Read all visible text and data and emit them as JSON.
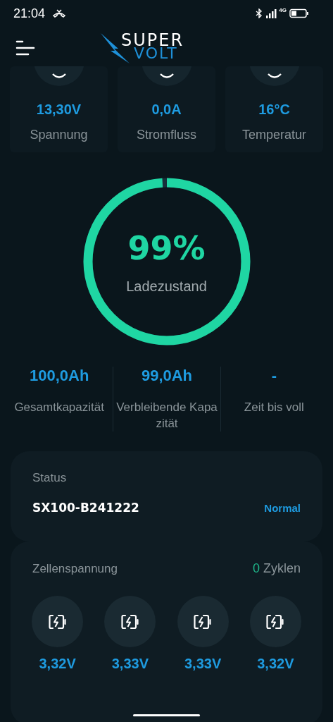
{
  "status_bar": {
    "time": "21:04",
    "network": "4G"
  },
  "header": {
    "logo_top": "SUPER",
    "logo_bottom": "VOLT"
  },
  "metrics": [
    {
      "value": "13,30V",
      "label": "Spannung"
    },
    {
      "value": "0,0A",
      "label": "Stromfluss"
    },
    {
      "value": "16°C",
      "label": "Temperatur"
    }
  ],
  "charge": {
    "percent": "99%",
    "label": "Ladezustand",
    "level": 0.99
  },
  "capacity": [
    {
      "value": "100,0Ah",
      "label": "Gesamtkapazität"
    },
    {
      "value": "99,0Ah",
      "label": "Verbleibende Kapazität"
    },
    {
      "value": "-",
      "label": "Zeit bis voll"
    }
  ],
  "status": {
    "title": "Status",
    "device": "SX100-B241222",
    "state": "Normal"
  },
  "cells": {
    "title": "Zellenspannung",
    "cycles": "0",
    "cycles_label": "Zyklen",
    "voltages": [
      "3,32V",
      "3,33V",
      "3,33V",
      "3,32V"
    ]
  }
}
